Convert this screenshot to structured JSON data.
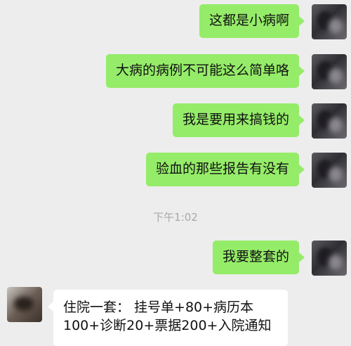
{
  "messages": [
    {
      "side": "right",
      "text": "这都是小病啊"
    },
    {
      "side": "right",
      "text": "大病的病例不可能这么简单咯"
    },
    {
      "side": "right",
      "text": "我是要用来搞钱的"
    },
    {
      "side": "right",
      "text": "验血的那些报告有没有"
    },
    {
      "side": "right",
      "text": "我要整套的"
    },
    {
      "side": "left",
      "line1": "住院一套： 挂号单+80+病历本",
      "line2": "100+诊断20+票据200+入院通知"
    }
  ],
  "timestamp": "下午1:02",
  "colors": {
    "self_bubble": "#95ec69",
    "other_bubble": "#ffffff",
    "background": "#ededed"
  }
}
